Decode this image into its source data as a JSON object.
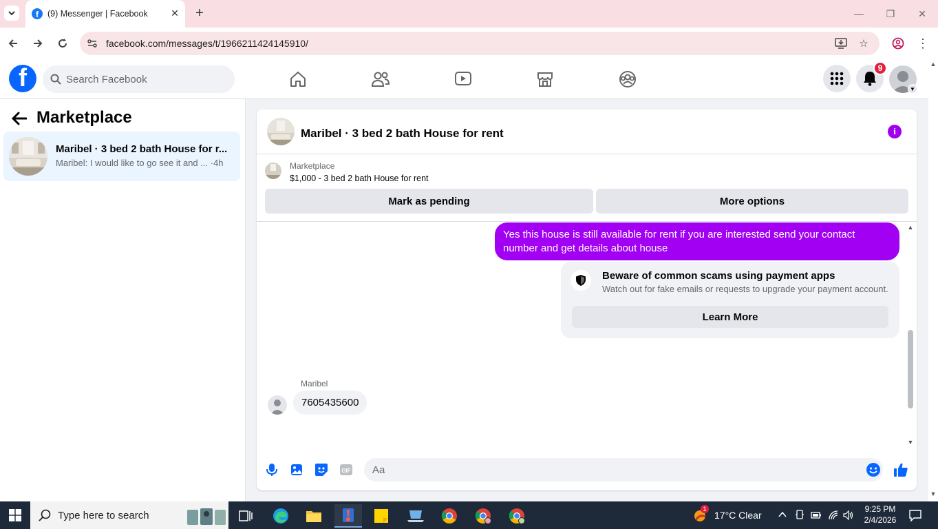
{
  "browser": {
    "tab_title": "(9) Messenger | Facebook",
    "url": "facebook.com/messages/t/1966211424145910/",
    "icons": [
      "tab-dropdown-icon",
      "facebook-favicon",
      "close-icon",
      "new-tab-icon",
      "minimize-icon",
      "restore-icon",
      "window-close-icon",
      "back-icon",
      "forward-icon",
      "reload-icon",
      "site-info-icon",
      "install-app-icon",
      "bookmark-star-icon",
      "profile-icon",
      "kebab-menu-icon"
    ]
  },
  "facebook": {
    "search_placeholder": "Search Facebook",
    "nav": [
      "home-icon",
      "friends-icon",
      "watch-icon",
      "marketplace-icon",
      "groups-icon"
    ],
    "notification_count": "9",
    "accent": "#0866ff"
  },
  "sidebar": {
    "title": "Marketplace",
    "conversation": {
      "name": "Maribel · 3 bed 2 bath House for r...",
      "preview": "Maribel: I would like to go see it and ...",
      "time": "·4h"
    }
  },
  "chat": {
    "title": "Maribel · 3 bed 2 bath House for rent",
    "listing_label": "Marketplace",
    "listing_price": "$1,000 - 3 bed 2 bath House for rent",
    "mark_pending": "Mark as pending",
    "more_options": "More options",
    "outgoing_message": "Yes this house is still available for rent if you are interested send your contact number and get details about house",
    "warning_title": "Beware of common scams using payment apps",
    "warning_body": "Watch out for fake emails or requests to upgrade your payment account.",
    "learn_more": "Learn More",
    "sender_name": "Maribel",
    "incoming_message": "7605435600",
    "composer_placeholder": "Aa",
    "bubble_color": "#a100f2"
  },
  "taskbar": {
    "search_placeholder": "Type here to search",
    "weather": "17°C  Clear",
    "weather_badge": "1",
    "time": "9:25 PM",
    "date": "2/4/2026"
  }
}
